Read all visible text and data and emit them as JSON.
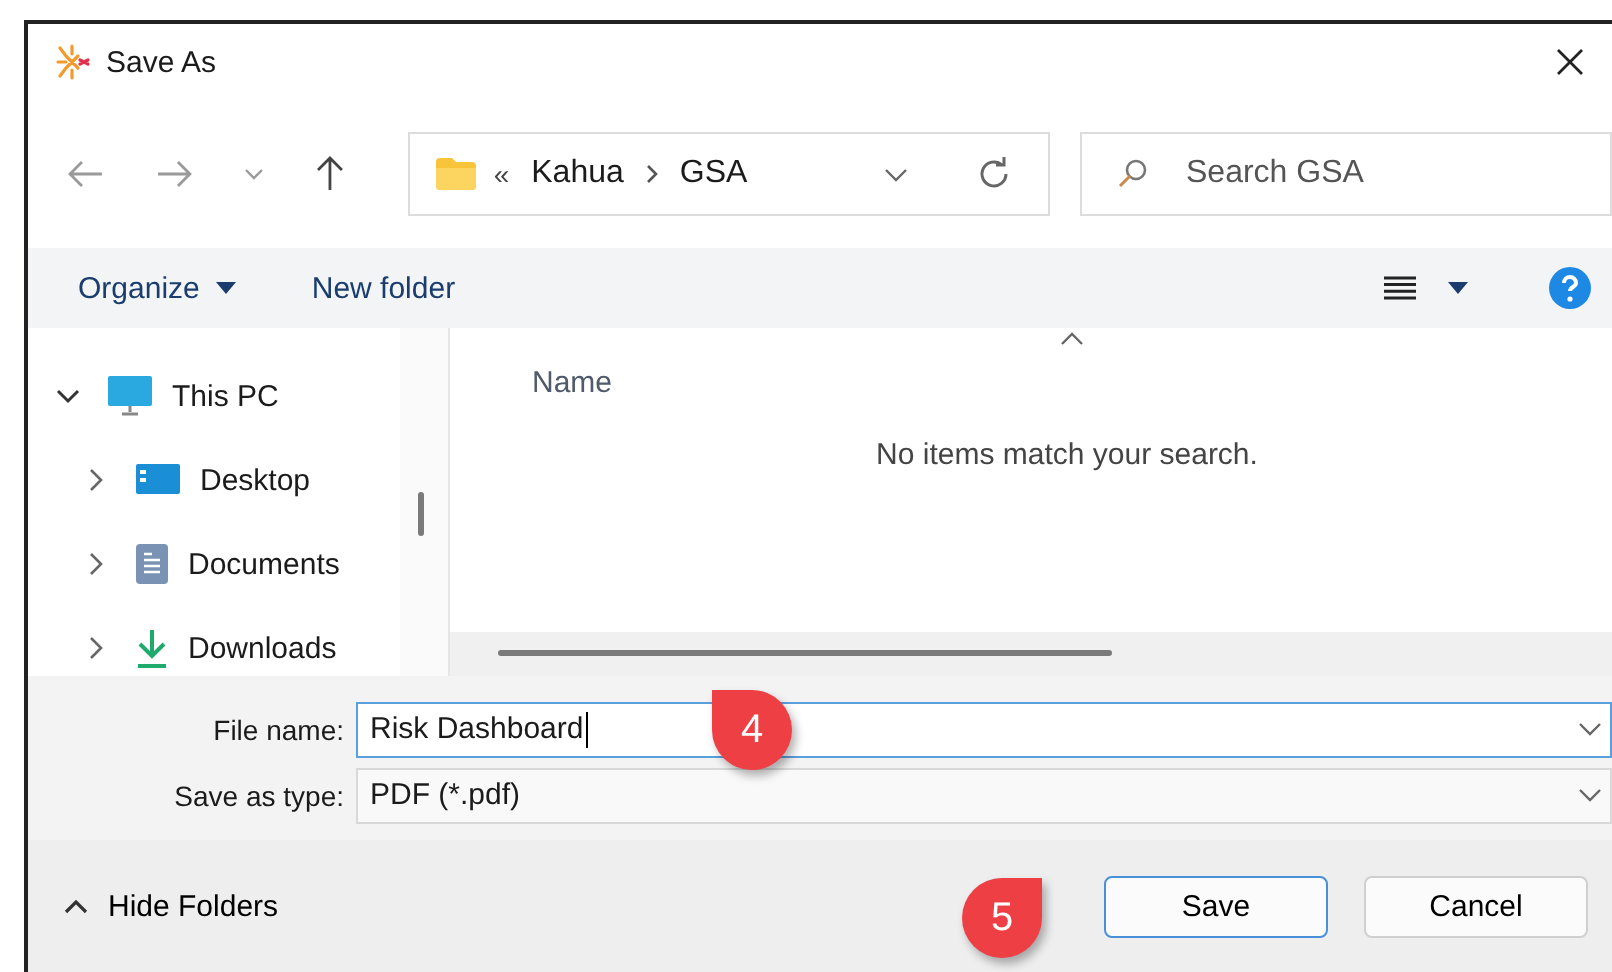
{
  "window": {
    "title": "Save As"
  },
  "address": {
    "overflow": "«",
    "path": [
      "Kahua",
      "GSA"
    ]
  },
  "search": {
    "placeholder": "Search GSA"
  },
  "toolbar": {
    "organize": "Organize",
    "new_folder": "New folder"
  },
  "tree": [
    {
      "label": "This PC",
      "kind": "pc",
      "expanded": true,
      "children": [
        {
          "label": "Desktop",
          "kind": "desktop",
          "expanded": false
        },
        {
          "label": "Documents",
          "kind": "documents",
          "expanded": false
        },
        {
          "label": "Downloads",
          "kind": "downloads",
          "expanded": false
        }
      ]
    }
  ],
  "content": {
    "column": "Name",
    "empty_message": "No items match your search."
  },
  "fields": [
    {
      "label": "File name:",
      "value": "Risk Dashboard",
      "focused": true
    },
    {
      "label": "Save as type:",
      "value": "PDF (*.pdf)",
      "focused": false
    }
  ],
  "footer": {
    "hide_folders": "Hide Folders"
  },
  "buttons": [
    {
      "label": "Save",
      "kind": "primary"
    },
    {
      "label": "Cancel",
      "kind": "secondary"
    }
  ],
  "callouts": [
    {
      "label": "4"
    },
    {
      "label": "5"
    }
  ]
}
